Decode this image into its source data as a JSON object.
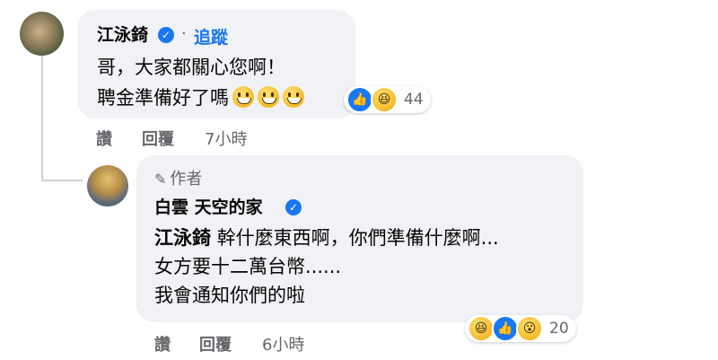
{
  "comment1": {
    "author": "江泳錡",
    "separator": "·",
    "follow_label": "追蹤",
    "lines": [
      "哥，大家都關心您啊！",
      "聘金準備好了嗎"
    ],
    "emoji_count": 3,
    "reaction_count": "44",
    "actions": {
      "like": "讚",
      "reply": "回覆"
    },
    "time": "7小時"
  },
  "comment2": {
    "author_badge": "作者",
    "author": "白雲 天空的家",
    "mention": "江泳錡",
    "lines": [
      "幹什麼東西啊，你們準備什麼啊...",
      "女方要十二萬台幣......",
      "我會通知你們的啦"
    ],
    "reaction_count": "20",
    "actions": {
      "like": "讚",
      "reply": "回覆"
    },
    "time": "6小時"
  },
  "colors": {
    "bubble": "#f0f2f5",
    "link": "#1877f2",
    "meta": "#65676b"
  },
  "icons": [
    "verified-badge-icon",
    "like-reaction-icon",
    "haha-reaction-icon",
    "wow-reaction-icon",
    "pen-icon",
    "grinning-emoji-icon"
  ]
}
